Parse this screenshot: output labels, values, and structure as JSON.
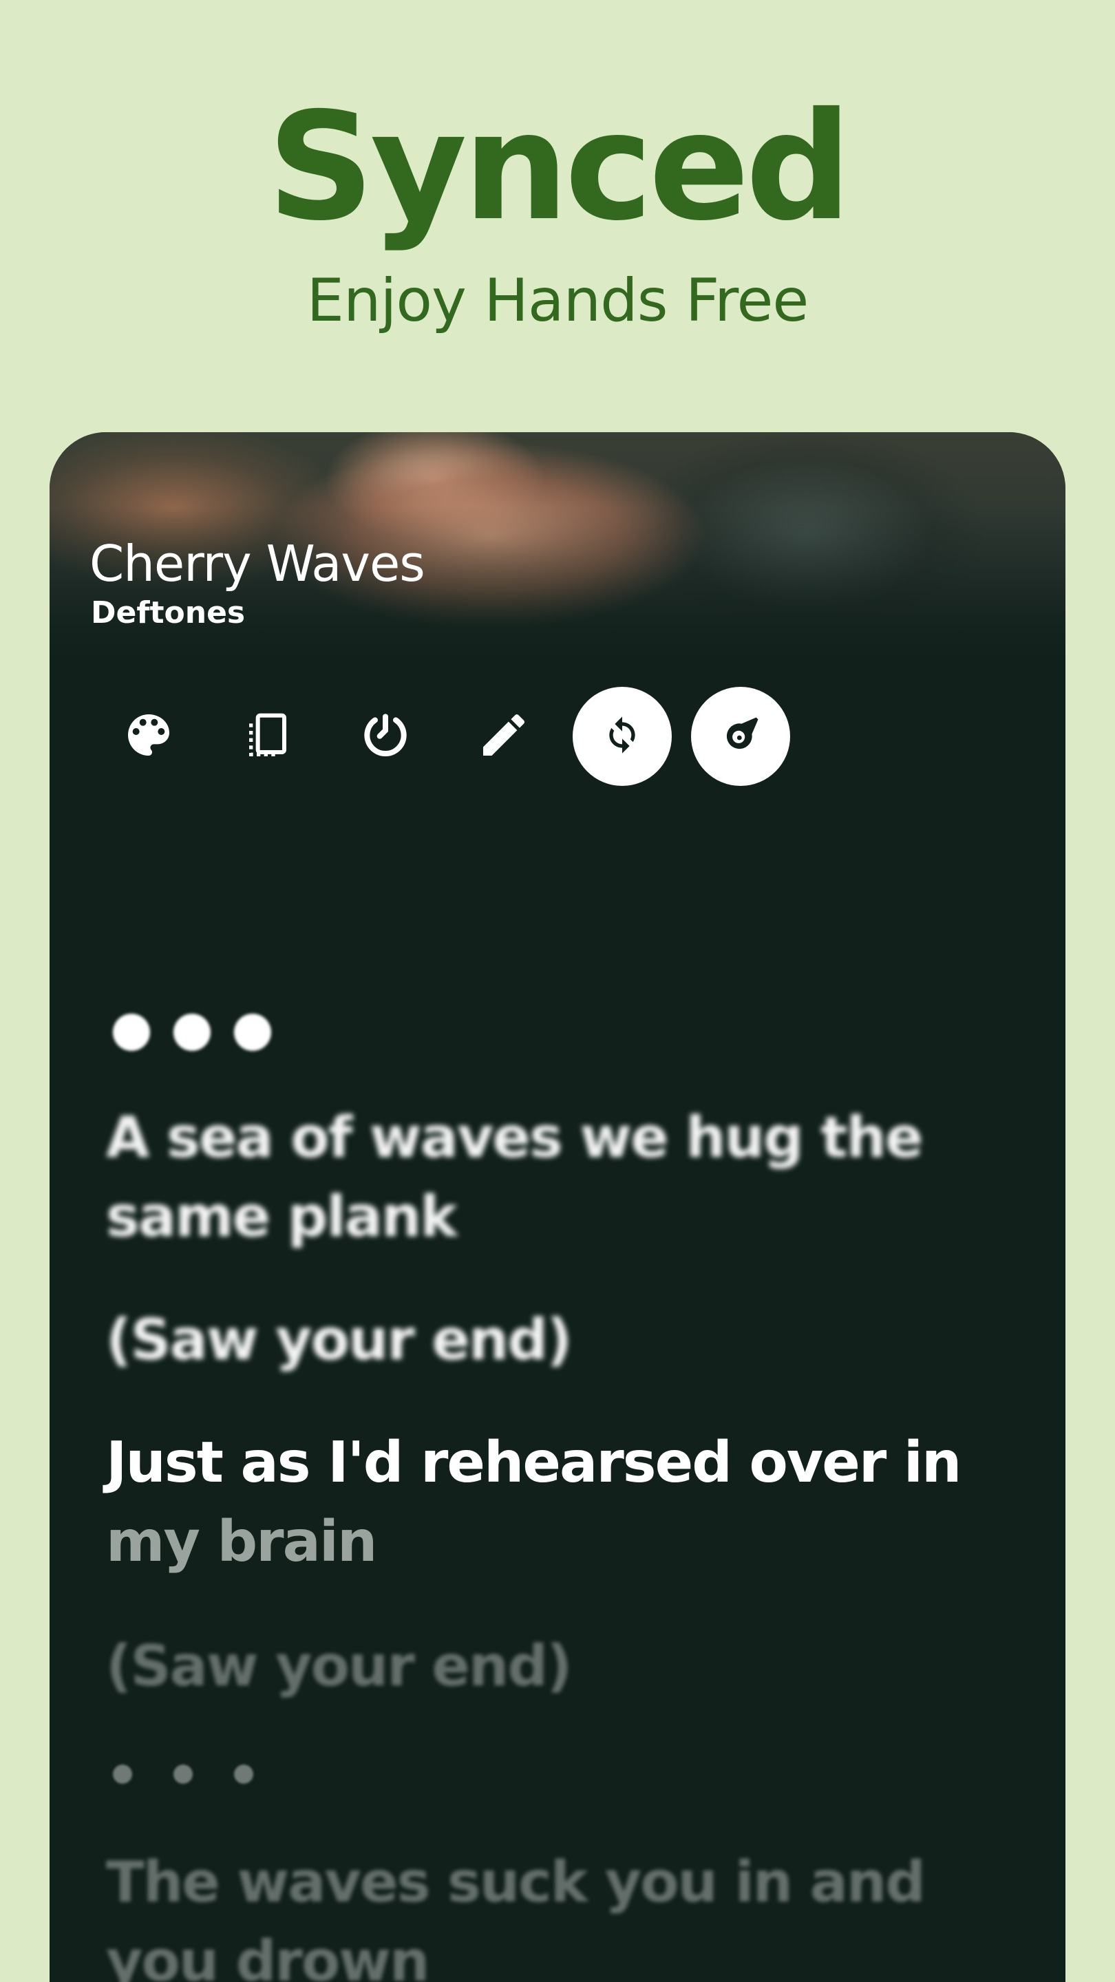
{
  "hero": {
    "title": "Synced",
    "subtitle": "Enjoy Hands Free"
  },
  "now_playing": {
    "song_title": "Cherry Waves",
    "artist": "Deftones"
  },
  "toolbar": {
    "buttons": [
      {
        "icon": "palette-icon",
        "active": false
      },
      {
        "icon": "tablet-layout-icon",
        "active": false
      },
      {
        "icon": "timer-icon",
        "active": false
      },
      {
        "icon": "edit-pencil-icon",
        "active": false
      },
      {
        "icon": "sync-icon",
        "active": true
      },
      {
        "icon": "meteor-icon",
        "active": true
      }
    ]
  },
  "lyrics": {
    "line_1": "A sea of waves we hug the same plank",
    "line_2": "(Saw your end)",
    "line_3_sung": "Just as I'd rehearsed over in",
    "line_3_rest": " my brain",
    "line_4": "(Saw your end)",
    "line_5": "The waves suck you in and you drown"
  },
  "colors": {
    "background": "#dcebc6",
    "accent_green": "#33691e",
    "card": "#11201b"
  }
}
